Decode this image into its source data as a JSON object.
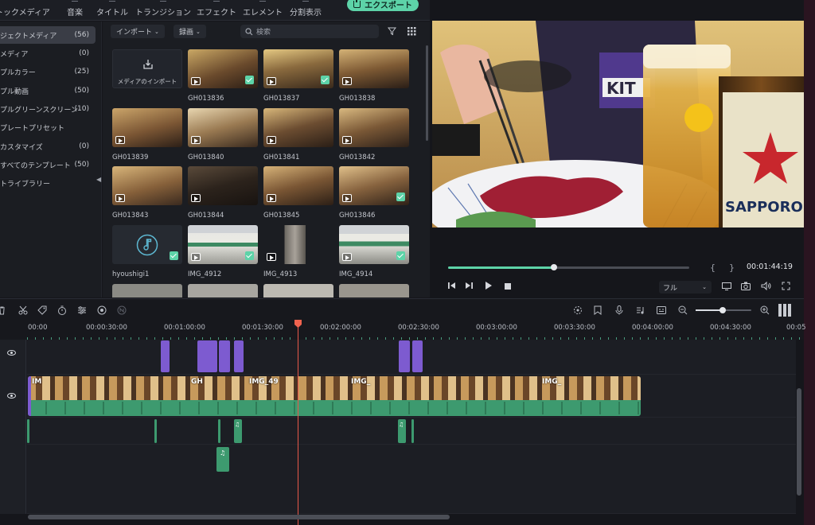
{
  "toolbar": {
    "tabs": [
      "トックメディア",
      "音楽",
      "タイトル",
      "トランジション",
      "エフェクト",
      "エレメント",
      "分割表示"
    ],
    "export_label": "エクスポート"
  },
  "sidebar": {
    "items": [
      {
        "label": "ジェクトメディア",
        "count": "(56)"
      },
      {
        "label": "メディア",
        "count": "(0)"
      },
      {
        "label": "プルカラー",
        "count": "(25)"
      },
      {
        "label": "プル動画",
        "count": "(50)"
      },
      {
        "label": "プルグリーンスクリーン",
        "count": "(10)"
      },
      {
        "label": "プレートプリセット",
        "count": ""
      },
      {
        "label": "カスタマイズ",
        "count": "(0)"
      },
      {
        "label": "すべてのテンプレート",
        "count": "(50)"
      },
      {
        "label": "トライブラリー",
        "count": ""
      }
    ]
  },
  "media": {
    "import_dropdown": "インポート",
    "record_dropdown": "録画",
    "search_placeholder": "検索",
    "import_tile_label": "メディアのインポート",
    "items": [
      {
        "name": "GH013836",
        "checked": true
      },
      {
        "name": "GH013837",
        "checked": true
      },
      {
        "name": "GH013838",
        "checked": false
      },
      {
        "name": "GH013839",
        "checked": false
      },
      {
        "name": "GH013840",
        "checked": false
      },
      {
        "name": "GH013841",
        "checked": false
      },
      {
        "name": "GH013842",
        "checked": false
      },
      {
        "name": "GH013843",
        "checked": false
      },
      {
        "name": "GH013844",
        "checked": false
      },
      {
        "name": "GH013845",
        "checked": false
      },
      {
        "name": "GH013846",
        "checked": true
      },
      {
        "name": "hyoushigi1",
        "checked": true
      },
      {
        "name": "IMG_4912",
        "checked": true
      },
      {
        "name": "IMG_4913",
        "checked": false
      },
      {
        "name": "IMG_4914",
        "checked": true
      }
    ]
  },
  "preview": {
    "timecode": "00:01:44:19",
    "zoom": "フル",
    "progress": 0.44,
    "brace_left": "{",
    "brace_right": "}",
    "beer_label_1": "KIT",
    "beer_label_2": "SAPPORO"
  },
  "timeline": {
    "ruler": [
      "00:00",
      "00:00:30:00",
      "00:01:00:00",
      "00:01:30:00",
      "00:02:00:00",
      "00:02:30:00",
      "00:03:00:00",
      "00:03:30:00",
      "00:04:00:00",
      "00:04:30:00",
      "00:05"
    ],
    "clip_labels": [
      "IM",
      "GH",
      "IMG_49",
      "IMG_",
      "IMG_"
    ],
    "playhead_time": "00:01:44:19"
  },
  "colors": {
    "accent": "#5dd3a8",
    "title_clip": "#7d5bd0",
    "audio_clip": "#3d9a6f",
    "playhead": "#e8584a"
  }
}
